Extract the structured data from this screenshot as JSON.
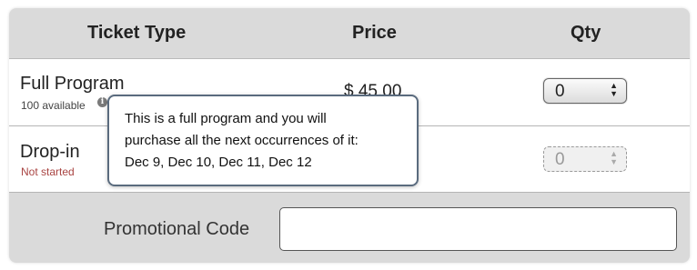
{
  "table": {
    "headers": {
      "ticket_type": "Ticket Type",
      "price": "Price",
      "qty": "Qty"
    },
    "rows": [
      {
        "name": "Full Program",
        "subtext": "100 available",
        "price": "$ 45.00",
        "qty": "0",
        "qty_enabled": true
      },
      {
        "name": "Drop-in",
        "subtext": "Not started",
        "price": "",
        "qty": "0",
        "qty_enabled": false
      }
    ]
  },
  "promo": {
    "label": "Promotional Code",
    "value": ""
  },
  "tooltip": {
    "lines": [
      "This is a full program and you will",
      "purchase all the next occurrences of it:",
      "Dec 9, Dec 10, Dec 11, Dec 12"
    ]
  },
  "icons": {
    "info": "info-icon",
    "spinner": "up-down-arrows-icon"
  },
  "colors": {
    "header_bg": "#dadada",
    "not_started": "#a94442",
    "tooltip_border": "#5a6b7e"
  }
}
